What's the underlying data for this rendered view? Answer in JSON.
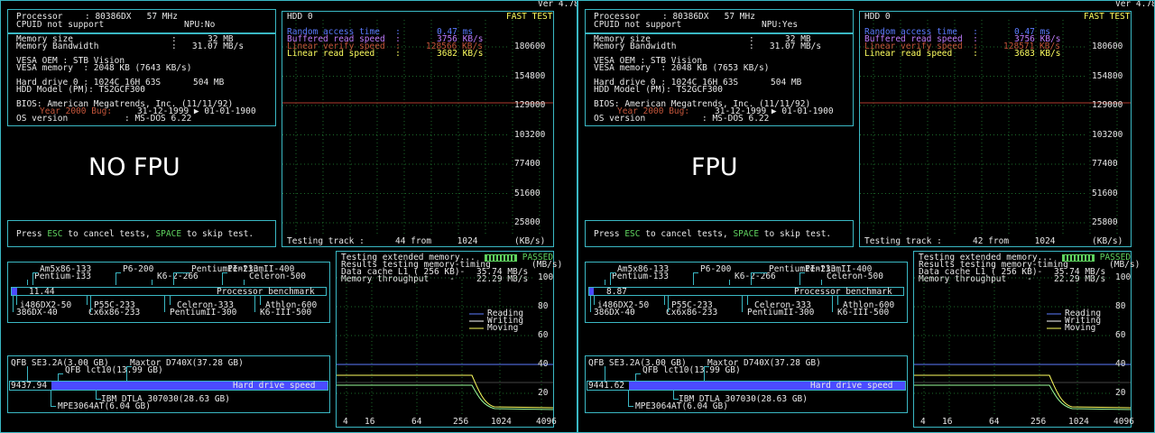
{
  "version": "Ver 4.78",
  "colors": {
    "accent": "#3ab8c4",
    "random": "#5b7bff",
    "buffered": "#c07cff",
    "verify": "#c4553a",
    "linear": "#ffff60",
    "redline": "#b03a2e",
    "gridGreen": "#1d6b2a",
    "esc": "#5fd35f",
    "blue_bar": "#4b4bff",
    "legend_reading": "#5b7bff",
    "legend_writing": "#ffffff",
    "legend_moving": "#ffff60"
  },
  "panels": [
    {
      "processor_label": "Processor",
      "processor_value": ": 80386DX   57 MHz",
      "cpuid": "CPUID not support",
      "npu": "NPU:No",
      "mem_size_label": "Memory size",
      "mem_size_value": ":      32 MB",
      "mem_bw_label": "Memory Bandwidth",
      "mem_bw_value": ":   31.07 MB/s",
      "vesa_oem": "VESA OEM : STB Vision",
      "vesa_mem": "VESA memory  : 2048 KB (7643 KB/s)",
      "hdd0_label": "Hard drive 0 : 1024C 16H 63S",
      "hdd0_size": "504 MB",
      "hdd_model": "HDD Model (PM): TS2GCF300",
      "bios": "BIOS: American Megatrends, Inc. (11/11/92)",
      "bios_date": "31-12-1999 ▶ 01-01-1900",
      "bios_year": "Year 2000 Bug:",
      "os_label": "OS version",
      "os_value": ": MS-DOS 6.22",
      "big_label": "NO FPU",
      "press_pre": "Press ",
      "press_esc": "ESC",
      "press_mid": " to cancel tests, ",
      "press_space": "SPACE",
      "press_post": " to skip test.",
      "hdd_title": "HDD 0",
      "fast_test": "FAST TEST",
      "random_label": "Random access time   :",
      "random_value": "0.47 ms",
      "buffered_label": "Buffered read speed  :",
      "buffered_value": "3756 KB/s",
      "verify_label": "Linear verify speed  :",
      "verify_value": "128566 KB/s",
      "linear_label": "Linear read speed    :",
      "linear_value": "3682 KB/s",
      "y_ticks": [
        "180600",
        "154800",
        "129000",
        "103200",
        "77400",
        "51600",
        "25800"
      ],
      "track_label": "Testing track :",
      "track_value": "44 from     1024",
      "track_unit": "(KB/s)",
      "cpu_top": [
        "Am5x86-133",
        "P6-200",
        "PentiumII-233",
        "PentiumII-400",
        "Pentium-133",
        "K6-2-266",
        "Celeron-500"
      ],
      "cpu_value": "11.44",
      "cpu_bench_label": "Processor benchmark",
      "cpu_bottom": [
        "i486DX2-50",
        "P55C-233",
        "Celeron-333",
        "Athlon-600",
        "386DX-40",
        "Cx6x86-233",
        "PentiumII-300",
        "K6-III-500"
      ],
      "hd_top": [
        "QFB SE3.2A(3.00 GB)",
        "Maxtor D740X(37.28 GB)",
        "QFB lct10(13.99 GB)"
      ],
      "hd_value": "9437.94",
      "hd_speed_label": "Hard drive speed",
      "hd_bottom": [
        "IBM DTLA 307030(28.63 GB)",
        "MPE3064AT(6.04 GB)"
      ],
      "mem_test_line": "Testing extended memory...",
      "passed": "PASSED",
      "mem_results": "Results testing memory-timing",
      "mem_unit": "(MB/s)",
      "cache_label": "Data cache L1 ( 256 KB)-",
      "cache_value": "35.74 MB/s",
      "throughput_label": "Memory throughput    -",
      "throughput_value": "22.29 MB/s",
      "mem_y_ticks": [
        "100",
        "80",
        "60",
        "40",
        "20"
      ],
      "legend": [
        "Reading",
        "Writing",
        "Moving"
      ],
      "mem_x_ticks": [
        "4",
        "16",
        "64",
        "256",
        "1024",
        "4096"
      ],
      "cpu_fill": 0.17,
      "hd_fill": 0.28,
      "redline_frac": 0.575,
      "sample_frac": 0.25
    },
    {
      "processor_label": "Processor",
      "processor_value": ": 80386DX   57 MHz",
      "cpuid": "CPUID not support",
      "npu": "NPU:Yes",
      "mem_size_label": "Memory size",
      "mem_size_value": ":      32 MB",
      "mem_bw_label": "Memory Bandwidth",
      "mem_bw_value": ":   31.07 MB/s",
      "vesa_oem": "VESA OEM : STB Vision",
      "vesa_mem": "VESA memory  : 2048 KB (7653 KB/s)",
      "hdd0_label": "Hard drive 0 : 1024C 16H 63S",
      "hdd0_size": "504 MB",
      "hdd_model": "HDD Model (PM): TS2GCF300",
      "bios": "BIOS: American Megatrends, Inc. (11/11/92)",
      "bios_date": "31-12-1999 ▶ 01-01-1900",
      "bios_year": "Year 2000 Bug:",
      "os_label": "OS version",
      "os_value": ": MS-DOS 6.22",
      "big_label": "FPU",
      "press_pre": "Press ",
      "press_esc": "ESC",
      "press_mid": " to cancel tests, ",
      "press_space": "SPACE",
      "press_post": " to skip test.",
      "hdd_title": "HDD 0",
      "fast_test": "FAST TEST",
      "random_label": "Random access time   :",
      "random_value": "0.47 ms",
      "buffered_label": "Buffered read speed  :",
      "buffered_value": "3756 KB/s",
      "verify_label": "Linear verify speed  :",
      "verify_value": "128571 KB/s",
      "linear_label": "Linear read speed    :",
      "linear_value": "3683 KB/s",
      "y_ticks": [
        "180600",
        "154800",
        "129000",
        "103200",
        "77400",
        "51600",
        "25800"
      ],
      "track_label": "Testing track :",
      "track_value": "42 from     1024",
      "track_unit": "(KB/s)",
      "cpu_top": [
        "Am5x86-133",
        "P6-200",
        "PentiumII-233",
        "PentiumII-400",
        "Pentium-133",
        "K6-2-266",
        "Celeron-500"
      ],
      "cpu_value": "8.87",
      "cpu_bench_label": "Processor benchmark",
      "cpu_bottom": [
        "i486DX2-50",
        "P55C-233",
        "Celeron-333",
        "Athlon-600",
        "386DX-40",
        "Cx6x86-233",
        "PentiumII-300",
        "K6-III-500"
      ],
      "hd_top": [
        "QFB SE3.2A(3.00 GB)",
        "Maxtor D740X(37.28 GB)",
        "QFB lct10(13.99 GB)"
      ],
      "hd_value": "9441.62",
      "hd_speed_label": "Hard drive speed",
      "hd_bottom": [
        "IBM DTLA 307030(28.63 GB)",
        "MPE3064AT(6.04 GB)"
      ],
      "mem_test_line": "Testing extended memory...",
      "passed": "PASSED",
      "mem_results": "Results testing memory-timing",
      "mem_unit": "(MB/s)",
      "cache_label": "Data cache L1 ( 256 KB)-",
      "cache_value": "35.74 MB/s",
      "throughput_label": "Memory throughput    -",
      "throughput_value": "22.29 MB/s",
      "mem_y_ticks": [
        "100",
        "80",
        "60",
        "40",
        "20"
      ],
      "legend": [
        "Reading",
        "Writing",
        "Moving"
      ],
      "mem_x_ticks": [
        "4",
        "16",
        "64",
        "256",
        "1024",
        "4096"
      ],
      "cpu_fill": 0.14,
      "hd_fill": 0.28,
      "redline_frac": 0.575,
      "sample_frac": 0.25
    }
  ]
}
